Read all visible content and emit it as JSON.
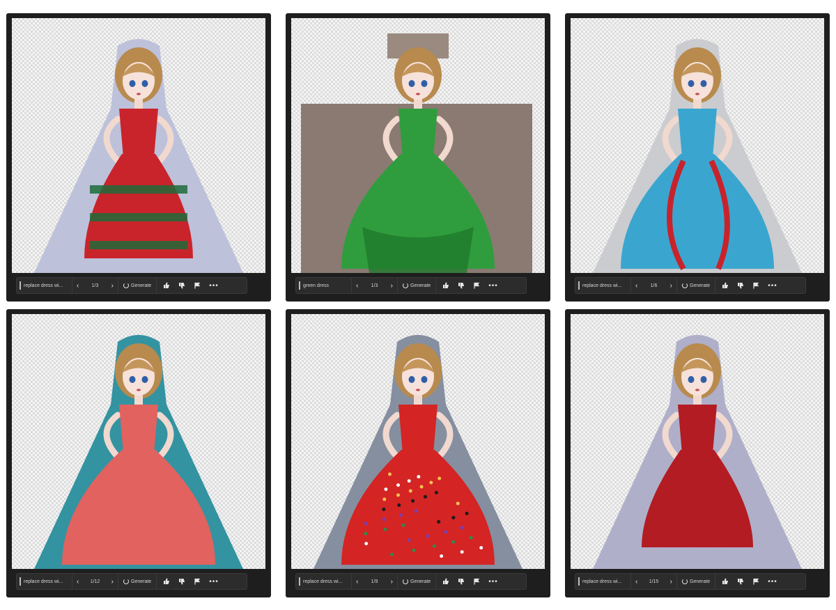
{
  "panels": [
    {
      "prompt": "replace dress wi...",
      "page": "1/3",
      "generate_label": "Generate",
      "dress_color": "#c9242b",
      "accent_color": "#1f6b3a",
      "bg_shape_color": "#b8bcd8",
      "style": "plaid-tiers"
    },
    {
      "prompt": "green dress",
      "page": "1/3",
      "generate_label": "Generate",
      "dress_color": "#2f9d3d",
      "accent_color": "#1f7a2c",
      "bg_shape_color": "#8a7a72",
      "style": "green-tutu"
    },
    {
      "prompt": "replace dress wi...",
      "page": "1/6",
      "generate_label": "Generate",
      "dress_color": "#3aa6cf",
      "accent_color": "#c8232c",
      "bg_shape_color": "#c8c9cc",
      "style": "blue-ribbon"
    },
    {
      "prompt": "replace dress wi...",
      "page": "1/12",
      "generate_label": "Generate",
      "dress_color": "#e2625f",
      "accent_color": "#1f8a99",
      "bg_shape_color": "#1f8a99",
      "style": "coral-gown"
    },
    {
      "prompt": "replace dress wi...",
      "page": "1/9",
      "generate_label": "Generate",
      "dress_color": "#d42424",
      "accent_color": "#7a8598",
      "bg_shape_color": "#7a8598",
      "style": "sequin-ball"
    },
    {
      "prompt": "replace dress wi...",
      "page": "1/15",
      "generate_label": "Generate",
      "dress_color": "#b31c22",
      "accent_color": "#a9a8c6",
      "bg_shape_color": "#a9a8c6",
      "style": "red-midi"
    }
  ],
  "icons": [
    "thumbs-up-icon",
    "thumbs-down-icon",
    "flag-icon",
    "more-icon"
  ]
}
